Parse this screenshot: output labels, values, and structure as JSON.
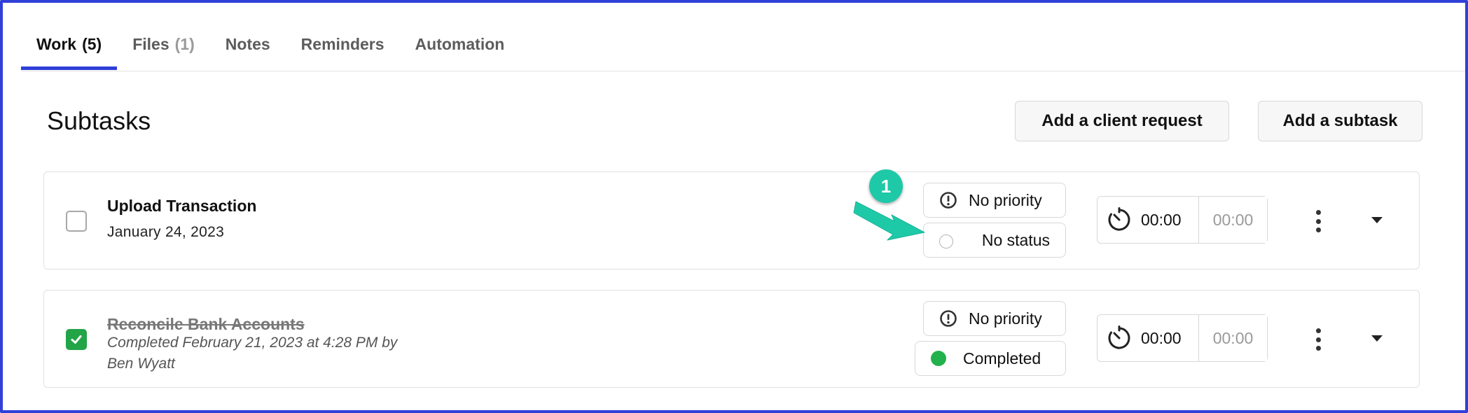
{
  "tabs": [
    {
      "label": "Work",
      "count": "(5)",
      "active": true
    },
    {
      "label": "Files",
      "count": "(1)",
      "active": false
    },
    {
      "label": "Notes",
      "count": "",
      "active": false
    },
    {
      "label": "Reminders",
      "count": "",
      "active": false
    },
    {
      "label": "Automation",
      "count": "",
      "active": false
    }
  ],
  "section": {
    "title": "Subtasks",
    "add_client_request_label": "Add a client request",
    "add_subtask_label": "Add a subtask"
  },
  "subtasks": [
    {
      "title": "Upload Transaction",
      "date": "January 24, 2023",
      "checked": false,
      "priority": "No priority",
      "status": "No status",
      "timer_value": "00:00",
      "timer_estimate": "00:00"
    },
    {
      "title": "Reconcile Bank Accounts",
      "completed_line1": "Completed February 21, 2023 at 4:28 PM by",
      "completed_line2": "Ben Wyatt",
      "checked": true,
      "priority": "No priority",
      "status": "Completed",
      "timer_value": "00:00",
      "timer_estimate": "00:00"
    }
  ],
  "annotation": {
    "step": "1"
  },
  "colors": {
    "accent": "#2f3fd8",
    "checked_green": "#22a447",
    "status_completed": "#22b14c",
    "annotation_teal": "#1ec9a8"
  },
  "icons": [
    "priority-exclamation-icon",
    "status-radio-icon",
    "timer-icon",
    "checkmark-icon",
    "kebab-menu-icon",
    "chevron-down-icon"
  ]
}
